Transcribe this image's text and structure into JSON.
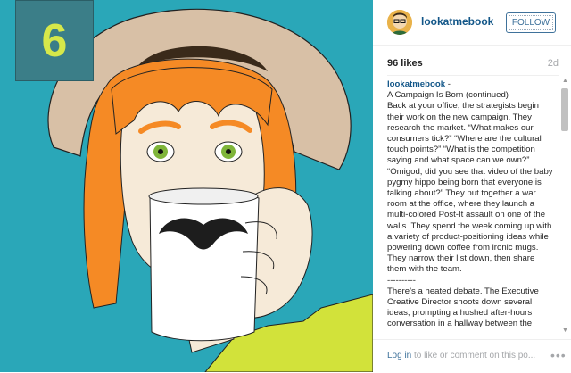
{
  "image": {
    "badge_number": "6",
    "colors": {
      "background": "#2aa7b8",
      "hat": "#d8c0a6",
      "hair": "#f58a25",
      "skin": "#f6ead8",
      "mug": "#ffffff",
      "mustache": "#1d1d1d",
      "eyes": "#7fb53a",
      "shirt": "#d2e23a"
    }
  },
  "post": {
    "username": "lookatmebook",
    "follow_label": "FOLLOW",
    "likes": "96 likes",
    "time_ago": "2d",
    "caption_user": "lookatmebook",
    "caption_user_suffix": " -",
    "caption_text": "A Campaign Is Born (continued)\nBack at your office, the strategists begin their work on the new campaign. They research the market. “What makes our consumers tick?” “Where are the cultural touch points?” “What is the competition saying and what space can we own?” “Omigod, did you see that video of the baby pygmy hippo being born that everyone is talking about?” They put together a war room at the office, where they launch a multi-colored Post-It assault on one of the walls. They spend the week coming up with a variety of product-positioning ideas while powering down coffee from ironic mugs. They narrow their list down, then share them with the team.\n----------\nThere’s a heated debate. The Executive Creative Director shoots down several ideas, prompting a hushed after-hours conversation in a hallway between the",
    "footer_link": "Log in",
    "footer_text": " to like or comment on this po...",
    "more_label": "•••"
  },
  "icons": {
    "scroll_up": "scroll-up-arrow-icon",
    "scroll_down": "scroll-down-arrow-icon",
    "more": "more-options-icon"
  }
}
